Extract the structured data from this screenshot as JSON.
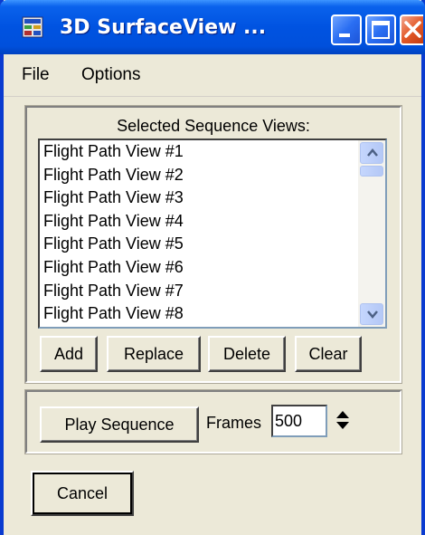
{
  "window": {
    "title": "3D SurfaceView ...",
    "colors": {
      "titlebar": "#0053E1",
      "frame": "#0A3BD0",
      "face": "#ECE9D8",
      "close": "#E45A2A"
    },
    "icons": [
      "app-icon",
      "minimize-icon",
      "maximize-icon",
      "close-icon"
    ]
  },
  "menu": {
    "file": "File",
    "options": "Options"
  },
  "sequence": {
    "title": "Selected Sequence Views:",
    "items": [
      "Flight Path View #1",
      "Flight Path View #2",
      "Flight Path View #3",
      "Flight Path View #4",
      "Flight Path View #5",
      "Flight Path View #6",
      "Flight Path View #7",
      "Flight Path View #8"
    ],
    "buttons": {
      "add": "Add",
      "replace": "Replace",
      "delete": "Delete",
      "clear": "Clear"
    }
  },
  "playback": {
    "play_label": "Play Sequence",
    "frames_label": "Frames",
    "frames_value": "500"
  },
  "footer": {
    "cancel_label": "Cancel"
  }
}
